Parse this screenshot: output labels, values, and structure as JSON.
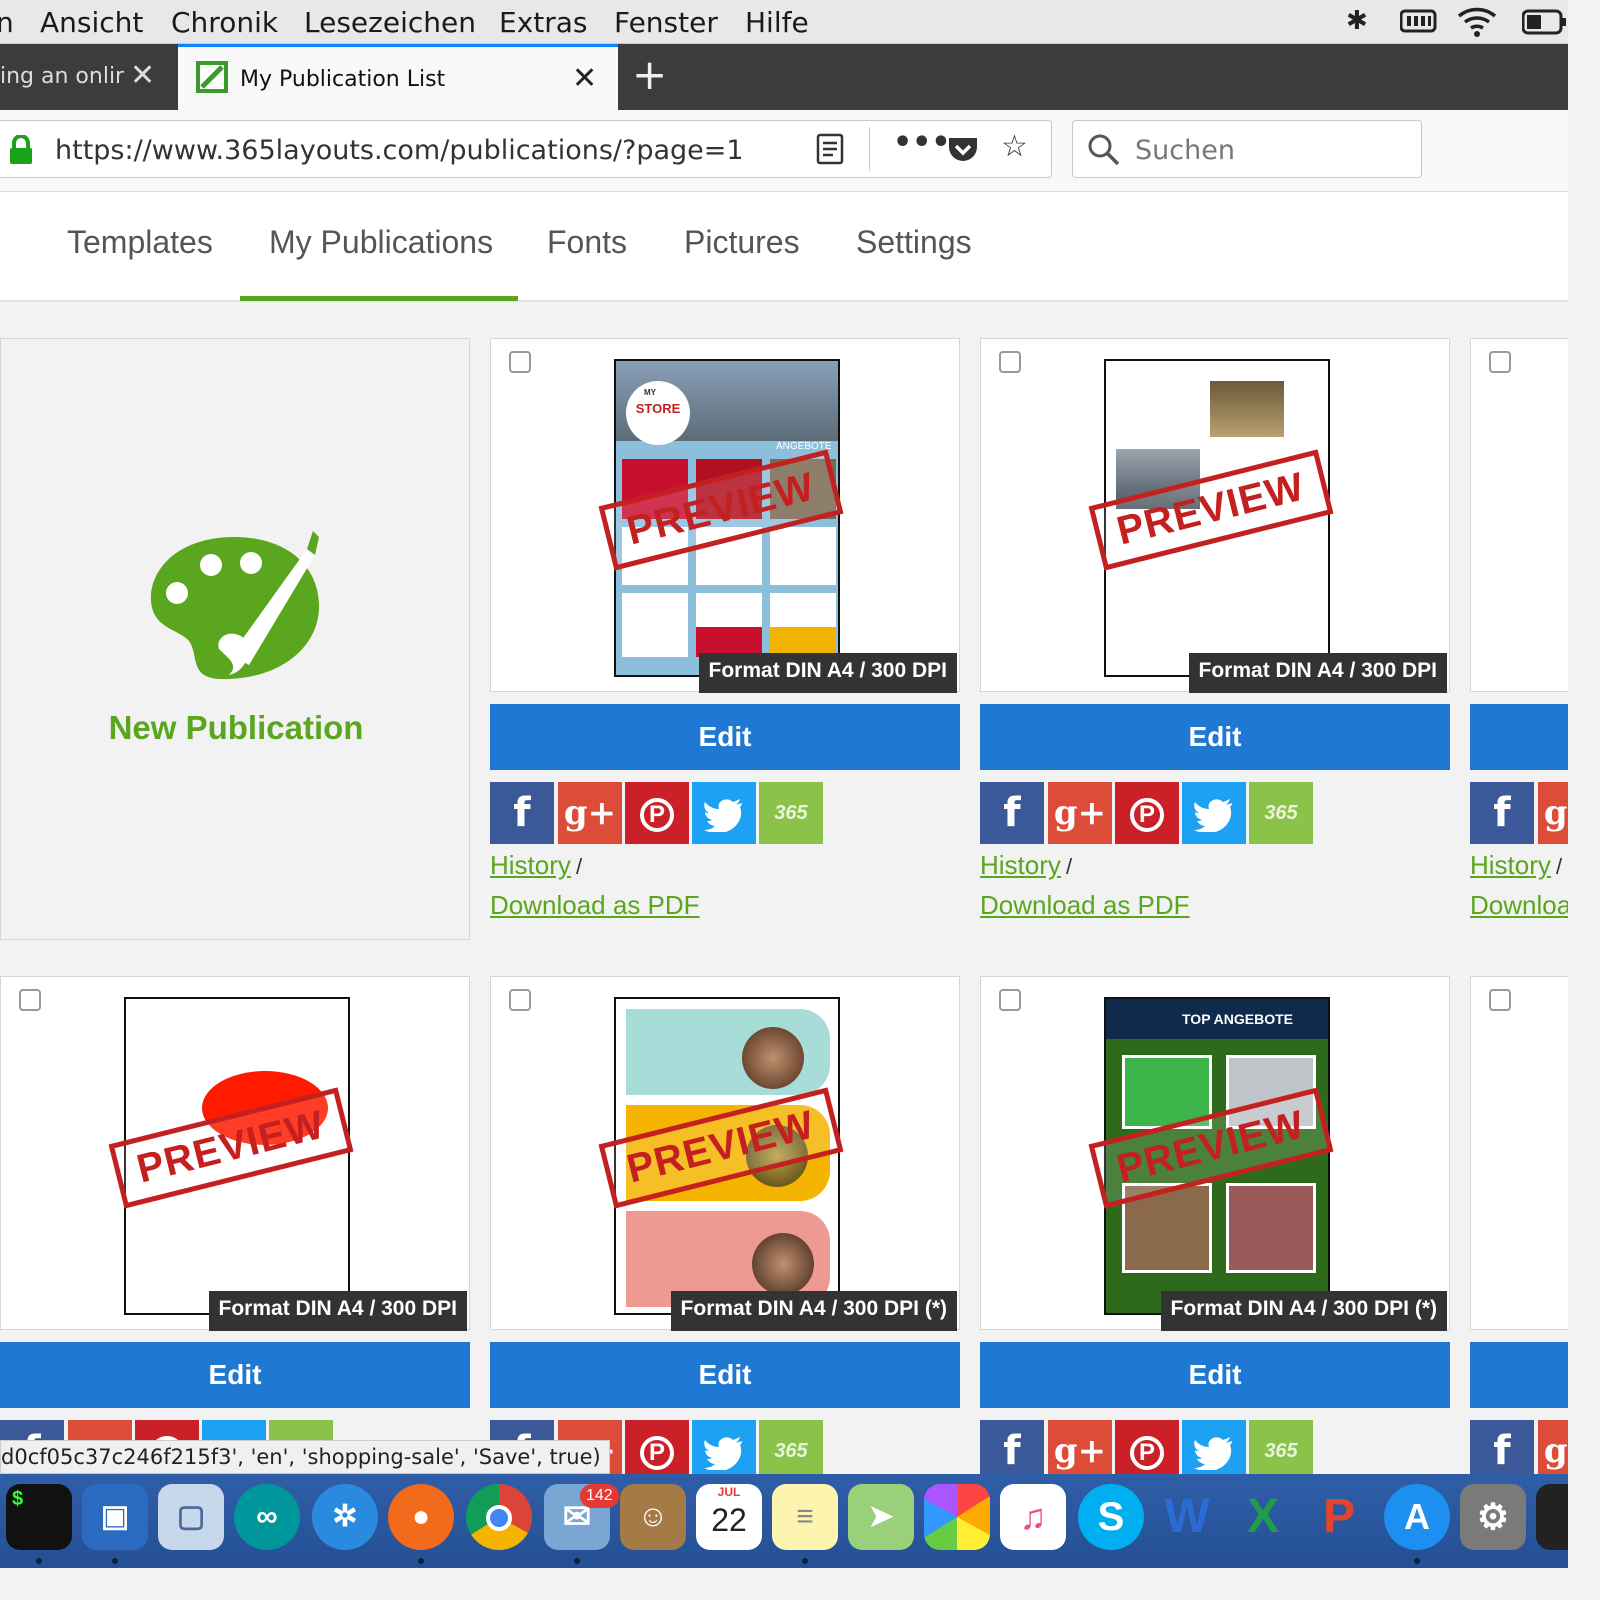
{
  "menubar": {
    "items": [
      "Ansicht",
      "Chronik",
      "Lesezeichen",
      "Extras",
      "Fenster",
      "Hilfe"
    ]
  },
  "browser": {
    "tabs": [
      {
        "title": "ing an onlin"
      },
      {
        "title": "My Publication List"
      }
    ],
    "url": "https://www.365layouts.com/publications/?page=1",
    "search_placeholder": "Suchen"
  },
  "site_nav": {
    "tabs": [
      "Templates",
      "My Publications",
      "Fonts",
      "Pictures",
      "Settings"
    ],
    "active": "My Publications"
  },
  "new_publication": {
    "label": "New Publication"
  },
  "publications": [
    {
      "format": "Format DIN A4 / 300 DPI",
      "preview": "PREVIEW",
      "store_badge": "STORE",
      "badge_small": "MY",
      "offers_label": "ANGEBOTE"
    },
    {
      "format": "Format DIN A4 / 300 DPI",
      "preview": "PREVIEW"
    },
    {
      "format": "Format DIN A4 / 300 DPI",
      "preview": "PREVIEW"
    },
    {
      "format": "Format DIN A4 / 300 DPI (*)",
      "preview": "PREVIEW"
    },
    {
      "format": "Format DIN A4 / 300 DPI (*)",
      "preview": "PREVIEW",
      "thumb_title": "TOP ANGEBOTE"
    }
  ],
  "card_actions": {
    "edit": "Edit",
    "history": "History",
    "separator": "/",
    "download": "Download as PDF",
    "download_partial": "Downloa",
    "share": {
      "facebook": "f",
      "gplus": "g+",
      "pinterest": "P",
      "twitter": "t",
      "layouts": "365"
    }
  },
  "statusbar": {
    "text": "d0cf05c37c246f215f3', 'en', 'shopping-sale', 'Save', true)"
  },
  "dock": {
    "calendar_month": "JUL",
    "calendar_day": "22",
    "mail_badge": "142"
  },
  "colors": {
    "accent_green": "#5aa61e",
    "edit_blue": "#1f78d1",
    "preview_red": "#c42020"
  }
}
